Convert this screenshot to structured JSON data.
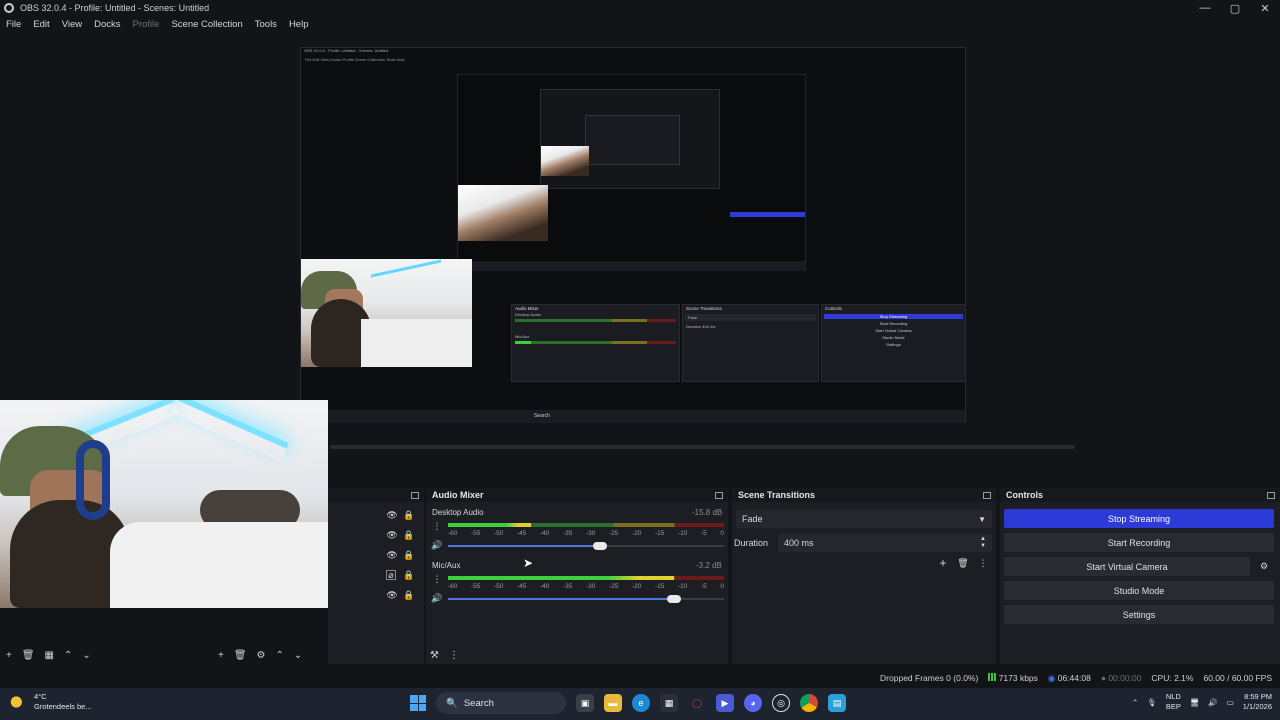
{
  "window": {
    "title": "OBS 32.0.4 - Profile: Untitled - Scenes: Untitled",
    "controls": [
      "—",
      "▢",
      "✕"
    ]
  },
  "menu": [
    "File",
    "Edit",
    "View",
    "Docks",
    "Profile",
    "Scene Collection",
    "Tools",
    "Help"
  ],
  "nested_preview": {
    "title": "OBS 32.0.4 - Profile: Untitled - Scenes: Untitled",
    "menu": "File  Edit  View  Docks  Profile  Scene Collection  Tools  Help",
    "labels": {
      "audio_mixer": "Audio Mixer",
      "desktop_audio": "Desktop Audio",
      "mic": "Mic/Aux",
      "scene_transitions": "Scene Transitions",
      "fade": "Fade",
      "duration": "Duration",
      "duration_val": "400 ms",
      "controls": "Controls",
      "stop_streaming": "Stop Streaming",
      "start_recording": "Start Recording",
      "start_virtual_camera": "Start Virtual Camera",
      "studio_mode": "Studio Mode",
      "settings": "Settings",
      "search": "Search"
    }
  },
  "audio_mixer": {
    "title": "Audio Mixer",
    "channels": [
      {
        "name": "Desktop Audio",
        "db": "-15.8 dB",
        "level": 0.3,
        "volume": 0.55
      },
      {
        "name": "Mic/Aux",
        "db": "-3.2 dB",
        "level": 0.82,
        "volume": 0.82
      }
    ],
    "ticks": [
      "-60",
      "-55",
      "-50",
      "-45",
      "-40",
      "-35",
      "-30",
      "-25",
      "-20",
      "-15",
      "-10",
      "-5",
      "0"
    ]
  },
  "scene_transitions": {
    "title": "Scene Transitions",
    "transition": "Fade",
    "duration_label": "Duration",
    "duration_value": "400 ms"
  },
  "controls": {
    "title": "Controls",
    "stop_streaming": "Stop Streaming",
    "start_recording": "Start Recording",
    "start_virtual_camera": "Start Virtual Camera",
    "studio_mode": "Studio Mode",
    "settings": "Settings"
  },
  "status": {
    "dropped_frames": "Dropped Frames 0 (0.0%)",
    "bitrate": "7173 kbps",
    "stream_time": "06:44:08",
    "rec_time": "00:00:00",
    "cpu": "CPU: 2.1%",
    "fps": "60.00 / 60.00 FPS"
  },
  "taskbar": {
    "temperature": "4°C",
    "weather": "Grotendeels be...",
    "search": "Search",
    "lang_top": "NLD",
    "lang_bottom": "BEP",
    "time": "8:59 PM",
    "date": "1/1/2026"
  },
  "colors": {
    "accent": "#2c3bd8",
    "background": "#131418",
    "dock": "#1d1e23"
  }
}
